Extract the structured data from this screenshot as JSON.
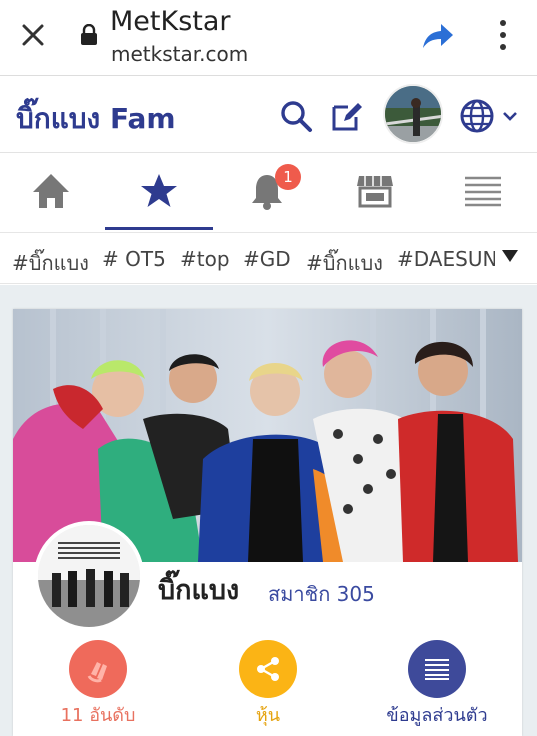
{
  "browser": {
    "title": "MetKstar",
    "url": "metkstar.com"
  },
  "header": {
    "brand": "บิ๊กแบง Fam"
  },
  "nav": {
    "active": "favorites",
    "notification_count": "1"
  },
  "tags": [
    "#บิ๊กแบง",
    "# OT5",
    "#top",
    "#GD",
    "#บิ๊กแบง",
    "#DAESUNG"
  ],
  "group": {
    "name": "บิ๊กแบง",
    "member_label": "สมาชิก 305"
  },
  "actions": [
    {
      "label": "11 อันดับ",
      "color": "#ef6a5b",
      "label_color": "#e8715f",
      "icon": "heart-hands-icon"
    },
    {
      "label": "หุ้น",
      "color": "#fbb415",
      "label_color": "#e5a30f",
      "icon": "share-icon"
    },
    {
      "label": "ข้อมูลส่วนตัว",
      "color": "#3e4a9a",
      "label_color": "#2e3b8f",
      "icon": "list-icon"
    }
  ],
  "colors": {
    "brand": "#2e3b8f",
    "badge": "#ef5b4c"
  }
}
